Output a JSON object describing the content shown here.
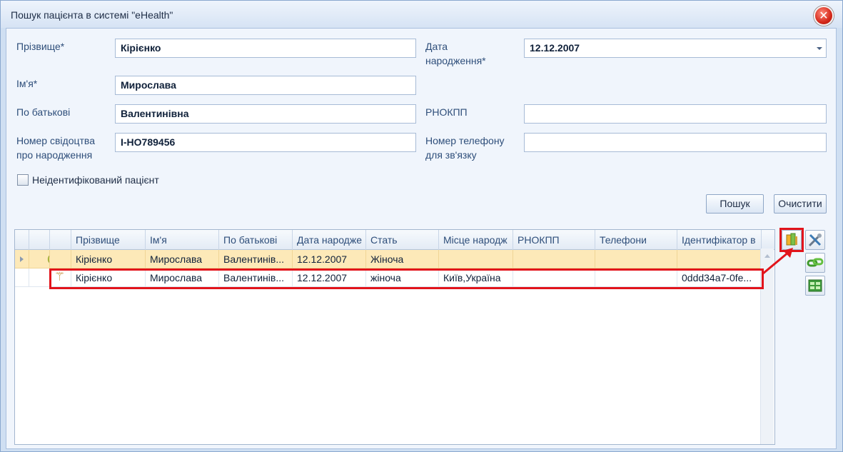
{
  "window": {
    "title": "Пошук пацієнта в системі \"eHealth\"",
    "close_glyph": "✕"
  },
  "form": {
    "surname": {
      "label": "Прізвище*",
      "value": "Кірієнко"
    },
    "first_name": {
      "label": "Ім'я*",
      "value": "Мирослава"
    },
    "patronymic": {
      "label": "По батькові",
      "value": "Валентинівна"
    },
    "birth_certificate": {
      "label_line1": "Номер свідоцтва",
      "label_line2": "про народження",
      "value": "I-HO789456"
    },
    "birth_date": {
      "label_line1": "Дата",
      "label_line2": "народження*",
      "value": "12.12.2007"
    },
    "rnokpp": {
      "label": "РНОКПП",
      "value": ""
    },
    "phone": {
      "label_line1": "Номер телефону",
      "label_line2": "для зв'язку",
      "value": ""
    },
    "unidentified": {
      "label": "Неідентифікований пацієнт",
      "checked": false
    }
  },
  "buttons": {
    "search": "Пошук",
    "clear": "Очистити"
  },
  "grid": {
    "columns": [
      "Прізвище",
      "Ім'я",
      "По батькові",
      "Дата народже",
      "Стать",
      "Місце народж",
      "РНОКПП",
      "Телефони",
      "Ідентифікатор в"
    ],
    "rows": [
      {
        "icon": "status-green-dot-icon",
        "selected": true,
        "surname": "Кірієнко",
        "first_name": "Мирослава",
        "patronymic": "Валентинів...",
        "birth_date": "12.12.2007",
        "gender": "Жіноча",
        "birth_place": "",
        "rnokpp": "",
        "phones": "",
        "ehealth_id": ""
      },
      {
        "icon": "caduceus-icon",
        "icon_glyph": "⚚",
        "selected": false,
        "surname": "Кірієнко",
        "first_name": "Мирослава",
        "patronymic": "Валентинів...",
        "birth_date": "12.12.2007",
        "gender": "жіноча",
        "birth_place": "Київ,Україна",
        "rnokpp": "",
        "phones": "",
        "ehealth_id": "0ddd34a7-0fe..."
      }
    ]
  },
  "toolbar": [
    "open-patient-icon",
    "tools-icon",
    "link-icon",
    "table-icon"
  ],
  "colors": {
    "accent_highlight": "#e2141b",
    "selected_row": "#fde9b8",
    "panel_bg": "#f0f5fc"
  }
}
